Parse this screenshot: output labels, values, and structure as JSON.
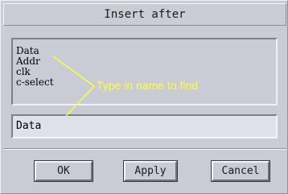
{
  "dialog": {
    "title": "Insert after"
  },
  "list": {
    "items": [
      {
        "label": "Data"
      },
      {
        "label": "Addr"
      },
      {
        "label": "clk"
      },
      {
        "label": "c-select"
      }
    ]
  },
  "annotation": {
    "text": "Type in name to find",
    "color": "#ffff33"
  },
  "search": {
    "value": "Data"
  },
  "buttons": {
    "ok": "OK",
    "apply": "Apply",
    "cancel": "Cancel"
  }
}
